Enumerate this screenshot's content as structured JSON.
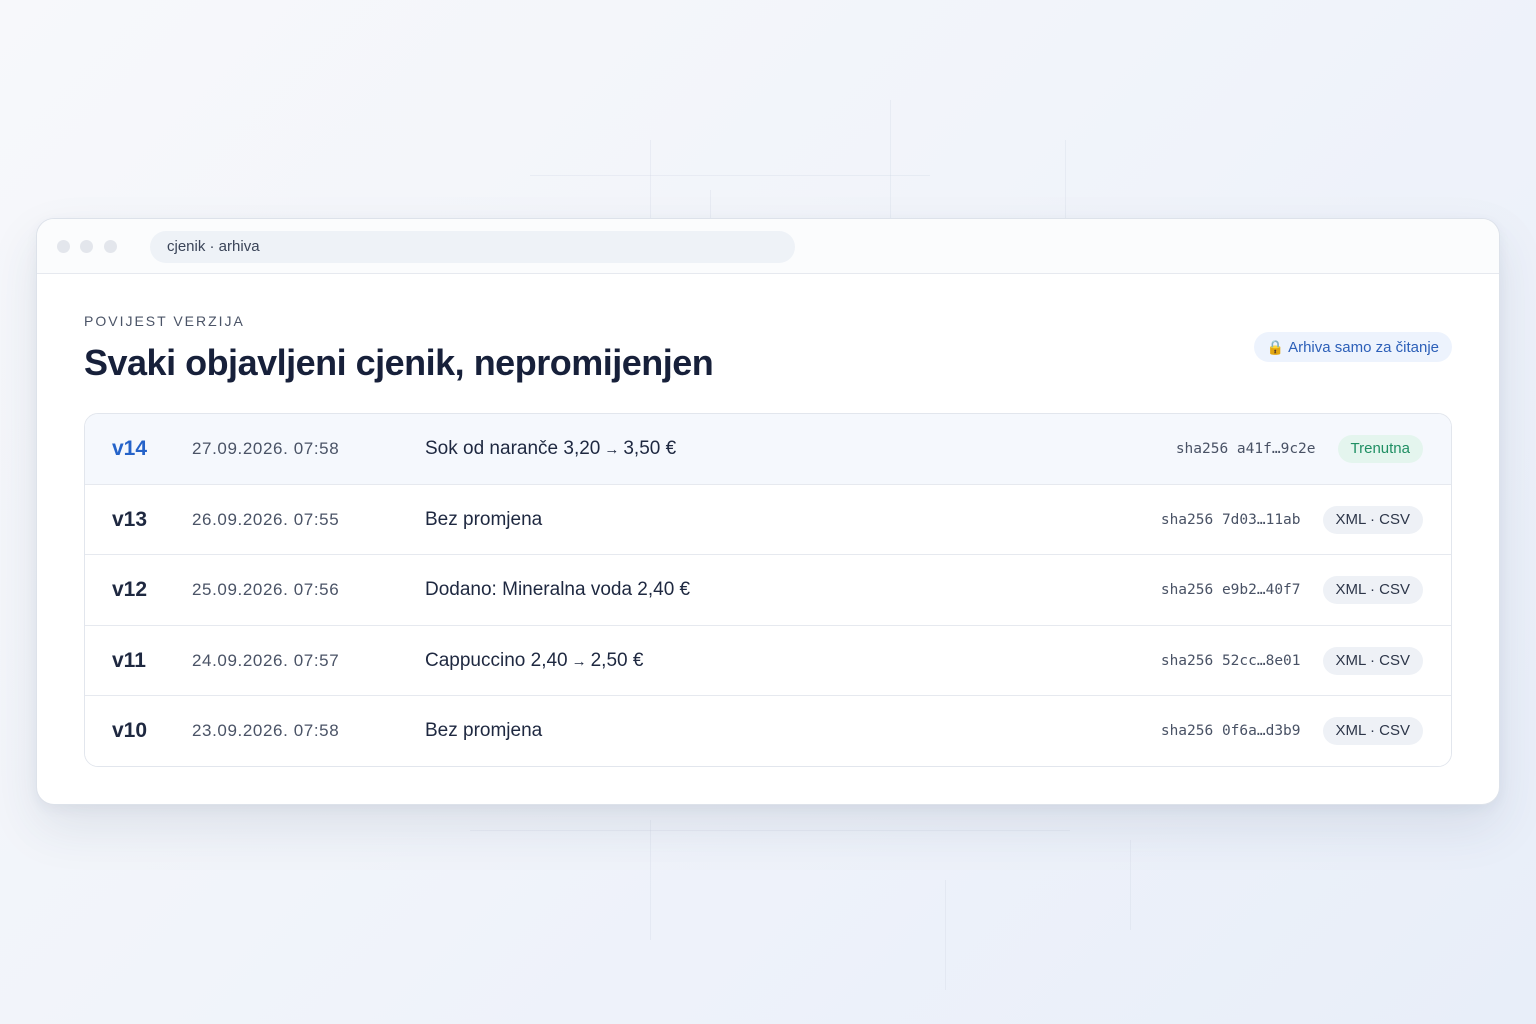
{
  "window": {
    "url": "cjenik · arhiva"
  },
  "header": {
    "eyebrow": "POVIJEST VERZIJA",
    "title": "Svaki objavljeni cjenik, nepromijenjen",
    "readonly_badge": "Arhiva samo za čitanje",
    "readonly_icon": "lock-icon"
  },
  "versions": [
    {
      "version": "v14",
      "date": "27.09.2026. 07:58",
      "change_before": "Sok od naranče 3,20",
      "arrow": "→",
      "change_after": "3,50 €",
      "hash": "sha256 a41f…9c2e",
      "tag": "Trenutna",
      "current": true
    },
    {
      "version": "v13",
      "date": "26.09.2026. 07:55",
      "change_before": "Bez promjena",
      "arrow": "",
      "change_after": "",
      "hash": "sha256 7d03…11ab",
      "tag": "XML · CSV",
      "current": false
    },
    {
      "version": "v12",
      "date": "25.09.2026. 07:56",
      "change_before": "Dodano: Mineralna voda 2,40 €",
      "arrow": "",
      "change_after": "",
      "hash": "sha256 e9b2…40f7",
      "tag": "XML · CSV",
      "current": false
    },
    {
      "version": "v11",
      "date": "24.09.2026. 07:57",
      "change_before": "Cappuccino 2,40",
      "arrow": "→",
      "change_after": "2,50 €",
      "hash": "sha256 52cc…8e01",
      "tag": "XML · CSV",
      "current": false
    },
    {
      "version": "v10",
      "date": "23.09.2026. 07:58",
      "change_before": "Bez promjena",
      "arrow": "",
      "change_after": "",
      "hash": "sha256 0f6a…d3b9",
      "tag": "XML · CSV",
      "current": false
    }
  ],
  "colors": {
    "accent": "#2563c9",
    "current_tag_bg": "#e4f5ee",
    "current_tag_text": "#1f8f63"
  }
}
